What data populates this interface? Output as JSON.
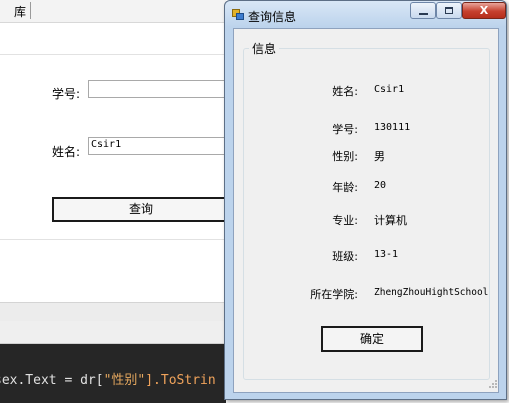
{
  "main_form": {
    "title_fragment": "库",
    "student_id_label": "学号:",
    "student_id_value": "",
    "name_label": "姓名:",
    "name_value": "Csir1",
    "query_button": "查询",
    "code_snippet": {
      "part1": "sex.Text = dr[",
      "part2": "\"性别\"",
      "part3": "].ToStrin"
    }
  },
  "dialog": {
    "title": "查询信息",
    "close_glyph": "X",
    "group_title": "信息",
    "fields": [
      {
        "label": "姓名:",
        "value": "Csir1"
      },
      {
        "label": "学号:",
        "value": "130111"
      },
      {
        "label": "性别:",
        "value": "男"
      },
      {
        "label": "年龄:",
        "value": "20"
      },
      {
        "label": "专业:",
        "value": "计算机"
      },
      {
        "label": "班级:",
        "value": "13-1"
      },
      {
        "label": "所在学院:",
        "value": "ZhengZhouHightSchool"
      }
    ],
    "ok_button": "确定"
  },
  "colors": {
    "window_frame": "#bcd3ec",
    "client_bg": "#f0f0f0",
    "close_button": "#c6402e",
    "code_bg": "#262626"
  },
  "icons": [
    "app-icon",
    "minimize-icon",
    "maximize-icon",
    "close-icon",
    "size-grip-icon"
  ]
}
